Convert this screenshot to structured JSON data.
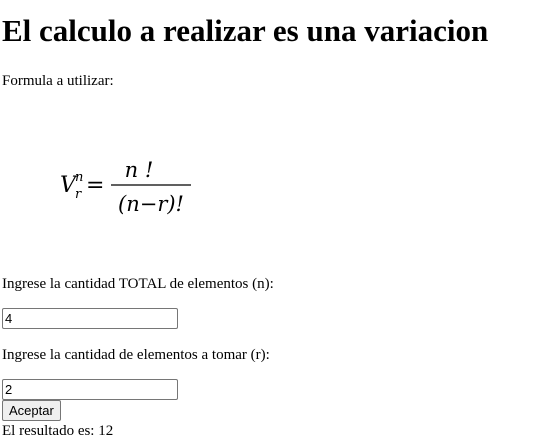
{
  "heading": "El calculo a realizar es una variacion",
  "formula_label": "Formula a utilizar:",
  "formula": {
    "lhs_symbol": "V",
    "lhs_superscript": "n",
    "lhs_subscript": "r",
    "equals": "=",
    "numerator": "n !",
    "denominator": "(n−r)!"
  },
  "inputs": {
    "n_label": "Ingrese la cantidad TOTAL de elementos (n):",
    "n_value": "4",
    "r_label": "Ingrese la cantidad de elementos a tomar (r):",
    "r_value": "2"
  },
  "submit_label": "Aceptar",
  "result_text": "El resultado es: 12"
}
